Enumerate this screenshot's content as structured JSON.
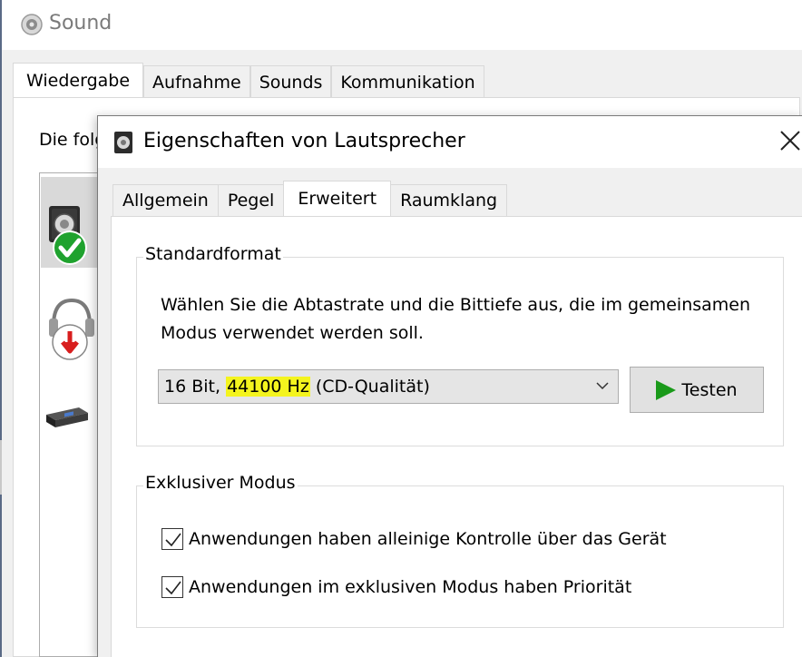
{
  "sound_window": {
    "title": "Sound",
    "tabs": [
      {
        "label": "Wiedergabe",
        "active": true
      },
      {
        "label": "Aufnahme",
        "active": false
      },
      {
        "label": "Sounds",
        "active": false
      },
      {
        "label": "Kommunikation",
        "active": false
      }
    ],
    "intro_text": "Die folg",
    "devices": [
      {
        "icon": "speaker-default-icon",
        "selected": true
      },
      {
        "icon": "headphones-disabled-icon",
        "selected": false
      },
      {
        "icon": "digital-output-icon",
        "selected": false
      }
    ]
  },
  "dialog": {
    "title": "Eigenschaften von Lautsprecher",
    "tabs": [
      {
        "label": "Allgemein",
        "active": false
      },
      {
        "label": "Pegel",
        "active": false
      },
      {
        "label": "Erweitert",
        "active": true
      },
      {
        "label": "Raumklang",
        "active": false
      }
    ],
    "standard_format": {
      "label": "Standardformat",
      "description": "Wählen Sie die Abtastrate und die Bittiefe aus, die im gemeinsamen Modus verwendet werden soll.",
      "select": {
        "prefix": "16 Bit, ",
        "highlighted": "44100 Hz",
        "suffix": " (CD-Qualität)"
      },
      "test_button": "Testen"
    },
    "exclusive_mode": {
      "label": "Exklusiver Modus",
      "options": [
        {
          "label": "Anwendungen haben alleinige Kontrolle über das Gerät",
          "checked": true
        },
        {
          "label": "Anwendungen im exklusiven Modus haben Priorität",
          "checked": true
        }
      ]
    }
  },
  "colors": {
    "highlight": "#f4f41e",
    "play_green": "#1a9a1a",
    "check_green": "#1fa22e",
    "disabled_red": "#d81e1e"
  }
}
